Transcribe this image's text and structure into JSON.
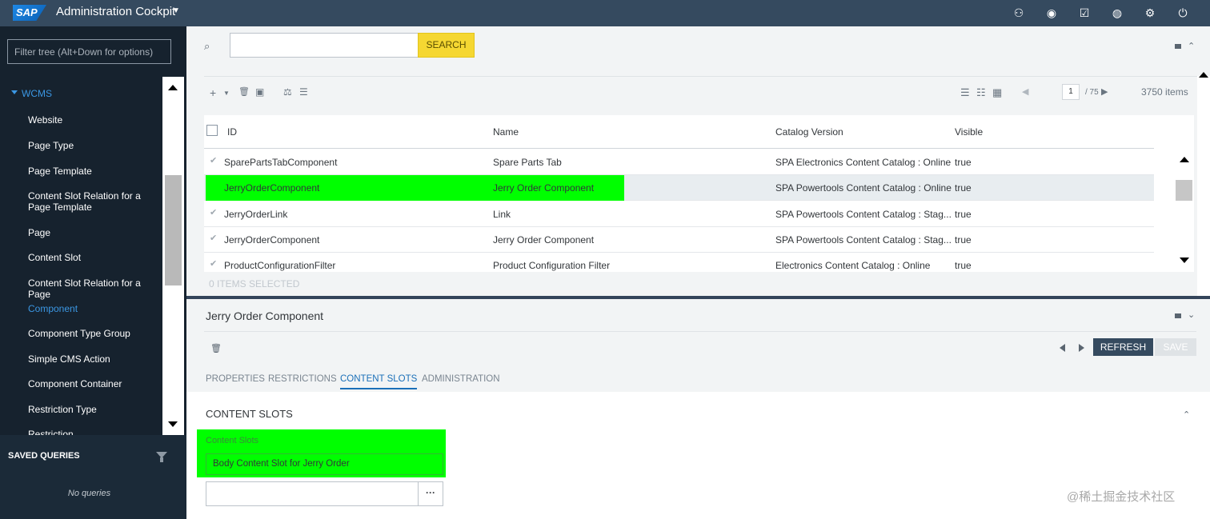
{
  "header": {
    "logo": "SAP",
    "app_title": "Administration Cockpit",
    "icons": [
      "user-settings-icon",
      "globe-icon",
      "checkbox-icon",
      "world-icon",
      "help-settings-icon",
      "power-icon"
    ]
  },
  "sidebar": {
    "filter_placeholder": "Filter tree (Alt+Down for options)",
    "group": "WCMS",
    "items": [
      {
        "label": "Website"
      },
      {
        "label": "Page Type"
      },
      {
        "label": "Page Template"
      },
      {
        "label": "Content Slot Relation for a Page Template"
      },
      {
        "label": "Page"
      },
      {
        "label": "Content Slot"
      },
      {
        "label": "Content Slot Relation for a Page"
      },
      {
        "label": "Component",
        "active": true
      },
      {
        "label": "Component Type Group"
      },
      {
        "label": "Simple CMS Action"
      },
      {
        "label": "Component Container"
      },
      {
        "label": "Restriction Type"
      },
      {
        "label": "Restriction"
      }
    ],
    "saved_queries": {
      "title": "SAVED QUERIES",
      "empty": "No queries"
    }
  },
  "search": {
    "button": "SEARCH",
    "value": ""
  },
  "list": {
    "pagination": {
      "page": "1",
      "total": "/ 75",
      "count": "3750 items"
    },
    "columns": [
      "ID",
      "Name",
      "Catalog Version",
      "Visible"
    ],
    "rows": [
      {
        "id": "SparePartsTabComponent",
        "name": "Spare Parts Tab",
        "catalog": "SPA Electronics Content Catalog : Online",
        "visible": "true"
      },
      {
        "id": "JerryOrderComponent",
        "name": "Jerry Order Component",
        "catalog": "SPA Powertools Content Catalog : Online",
        "visible": "true"
      },
      {
        "id": "JerryOrderLink",
        "name": "Link",
        "catalog": "SPA Powertools Content Catalog : Stag...",
        "visible": "true"
      },
      {
        "id": "JerryOrderComponent",
        "name": "Jerry Order Component",
        "catalog": "SPA Powertools Content Catalog : Stag...",
        "visible": "true"
      },
      {
        "id": "ProductConfigurationFilter",
        "name": "Product Configuration Filter",
        "catalog": "Electronics Content Catalog : Online",
        "visible": "true"
      }
    ],
    "selected_text": "0 ITEMS SELECTED"
  },
  "editor": {
    "title": "Jerry Order Component",
    "refresh": "REFRESH",
    "save": "SAVE",
    "tabs": [
      "PROPERTIES",
      "RESTRICTIONS",
      "CONTENT SLOTS",
      "ADMINISTRATION"
    ],
    "active_tab": "CONTENT SLOTS",
    "section_title": "CONTENT SLOTS",
    "field_label": "Content Slots",
    "slot_value": "Body Content Slot for Jerry Order",
    "browse": "···"
  },
  "watermark": "@稀土掘金技术社区",
  "colors": {
    "header": "#354a5f",
    "sidebar": "#16222e",
    "accent": "#3b97e3",
    "search_button": "#f5d732",
    "highlight": "#00ff00"
  }
}
